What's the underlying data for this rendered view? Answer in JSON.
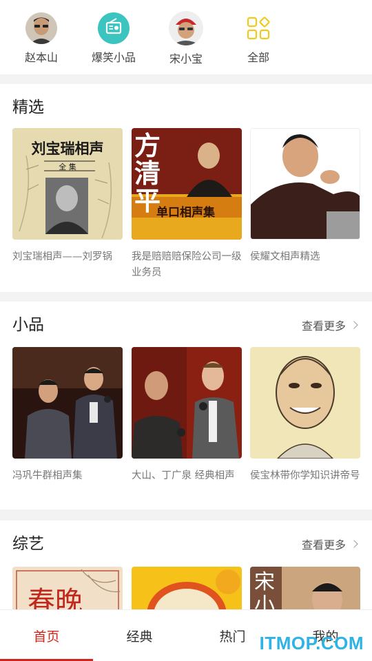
{
  "top_nav": [
    {
      "label": "赵本山",
      "icon": "zhao-benshan-avatar"
    },
    {
      "label": "爆笑小品",
      "icon": "radio-icon",
      "color": "#3cc5c0"
    },
    {
      "label": "宋小宝",
      "icon": "song-xiaobao-avatar"
    },
    {
      "label": "全部",
      "icon": "grid-icon",
      "color": "#f3c81c"
    }
  ],
  "sections": [
    {
      "title": "精选",
      "items": [
        {
          "caption": "刘宝瑞相声——刘罗锅",
          "cover_title": "刘宝瑞相声",
          "cover_sub": "全 集"
        },
        {
          "caption": "我是赔赔赔保险公司一级业务员",
          "cover_title": "方清平",
          "cover_sub": "单口相声集"
        },
        {
          "caption": "侯耀文相声精选"
        }
      ]
    },
    {
      "title": "小品",
      "more": "查看更多",
      "items": [
        {
          "caption": "冯巩牛群相声集"
        },
        {
          "caption": "大山、丁广泉 经典相声"
        },
        {
          "caption": "侯宝林带你学知识讲帝号"
        }
      ]
    },
    {
      "title": "综艺",
      "more": "查看更多",
      "items": [
        {
          "cover_text": "春晚"
        },
        {
          "cover_text": ""
        },
        {
          "cover_text": "宋小"
        }
      ]
    }
  ],
  "tabs": [
    {
      "label": "首页",
      "active": true
    },
    {
      "label": "经典"
    },
    {
      "label": "热门"
    },
    {
      "label": "我的"
    }
  ],
  "accent_color": "#d4231a",
  "watermark": "ITMOP.COM"
}
